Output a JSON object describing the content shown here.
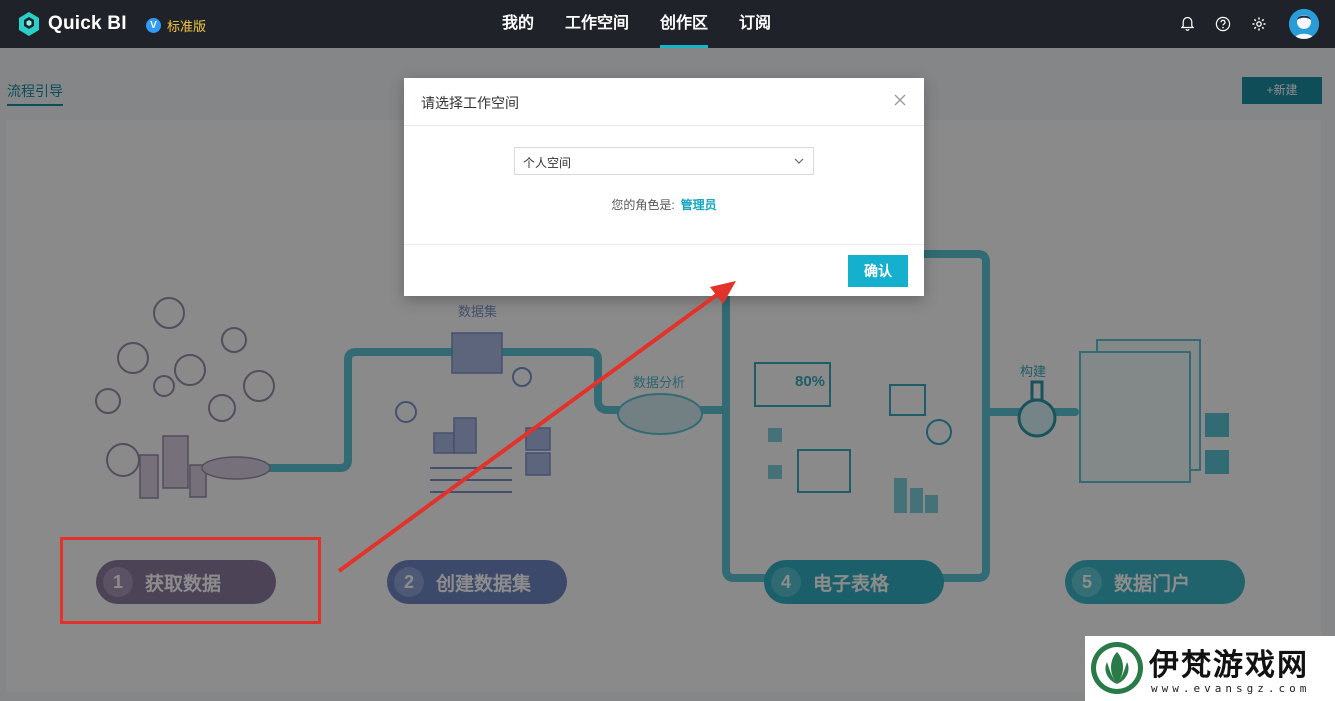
{
  "app": {
    "title": "Quick BI",
    "edition": "标准版",
    "edition_icon": "V"
  },
  "nav": {
    "items": [
      {
        "label": "我的",
        "active": false
      },
      {
        "label": "工作空间",
        "active": false
      },
      {
        "label": "创作区",
        "active": true
      },
      {
        "label": "订阅",
        "active": false
      }
    ]
  },
  "page": {
    "tab": "流程引导",
    "new_button": "+新建"
  },
  "diagram": {
    "labels": {
      "dataset": "数据集",
      "analysis": "数据分析",
      "build": "构建",
      "gauge_value": "80%"
    },
    "steps": [
      {
        "num": "1",
        "label": "获取数据",
        "color": "#8b7b9d"
      },
      {
        "num": "2",
        "label": "创建数据集",
        "color": "#6f86c4"
      },
      {
        "num": "4",
        "label": "电子表格",
        "color": "#31aec0"
      },
      {
        "num": "5",
        "label": "数据门户",
        "color": "#3bb5c6"
      }
    ]
  },
  "modal": {
    "title": "请选择工作空间",
    "select_value": "个人空间",
    "role_label": "您的角色是:",
    "role_value": "管理员",
    "confirm": "确认"
  },
  "watermark": {
    "title": "伊梵游戏网",
    "url": "www.evansgz.com"
  },
  "colors": {
    "topbar": "#1f2329",
    "accent": "#14b0cd",
    "annotation": "#e3322a"
  }
}
